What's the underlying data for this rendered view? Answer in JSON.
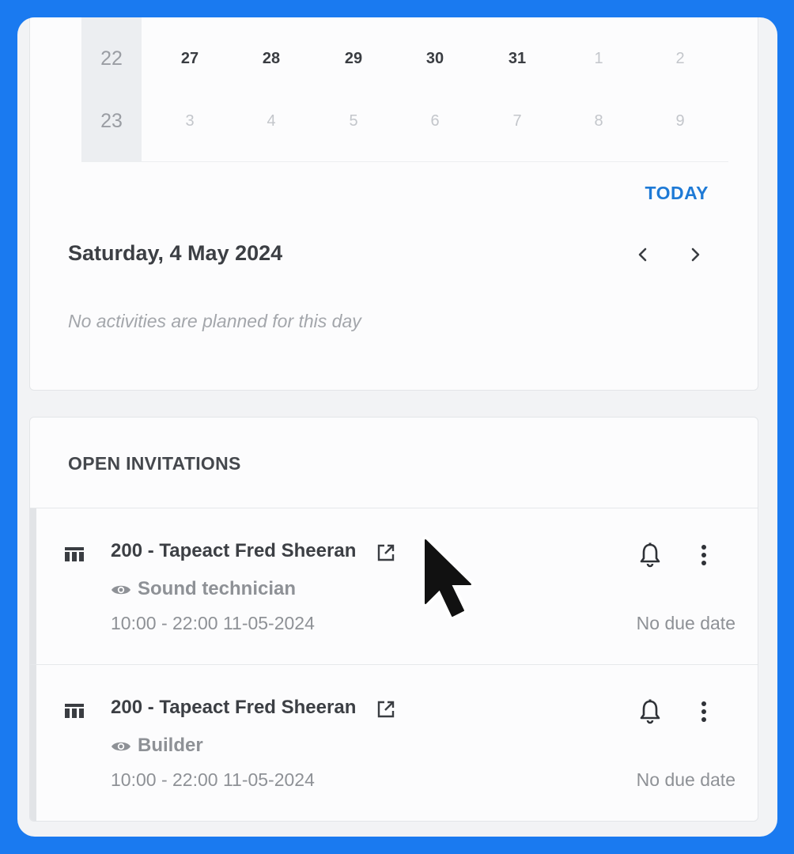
{
  "calendar": {
    "rows": [
      {
        "week": "22",
        "days": [
          {
            "d": "27",
            "current": true
          },
          {
            "d": "28",
            "current": true
          },
          {
            "d": "29",
            "current": true
          },
          {
            "d": "30",
            "current": true
          },
          {
            "d": "31",
            "current": true
          },
          {
            "d": "1",
            "current": false
          },
          {
            "d": "2",
            "current": false
          }
        ]
      },
      {
        "week": "23",
        "days": [
          {
            "d": "3",
            "current": false
          },
          {
            "d": "4",
            "current": false
          },
          {
            "d": "5",
            "current": false
          },
          {
            "d": "6",
            "current": false
          },
          {
            "d": "7",
            "current": false
          },
          {
            "d": "8",
            "current": false
          },
          {
            "d": "9",
            "current": false
          }
        ]
      }
    ],
    "today_label": "TODAY",
    "selected_date": "Saturday, 4 May 2024",
    "empty_message": "No activities are planned for this day"
  },
  "invitations": {
    "header": "OPEN INVITATIONS",
    "items": [
      {
        "title": "200 - Tapeact Fred Sheeran",
        "role": "Sound technician",
        "time": "10:00 - 22:00 11-05-2024",
        "due": "No due date"
      },
      {
        "title": "200 - Tapeact Fred Sheeran",
        "role": "Builder",
        "time": "10:00 - 22:00 11-05-2024",
        "due": "No due date"
      }
    ]
  },
  "colors": {
    "frame_background": "#1a7af0",
    "accent_link": "#1e7ad6"
  },
  "icons": [
    "table-icon",
    "external-link-icon",
    "eye-icon",
    "bell-icon",
    "more-vertical-icon",
    "chevron-left-icon",
    "chevron-right-icon",
    "mouse-pointer-icon"
  ]
}
